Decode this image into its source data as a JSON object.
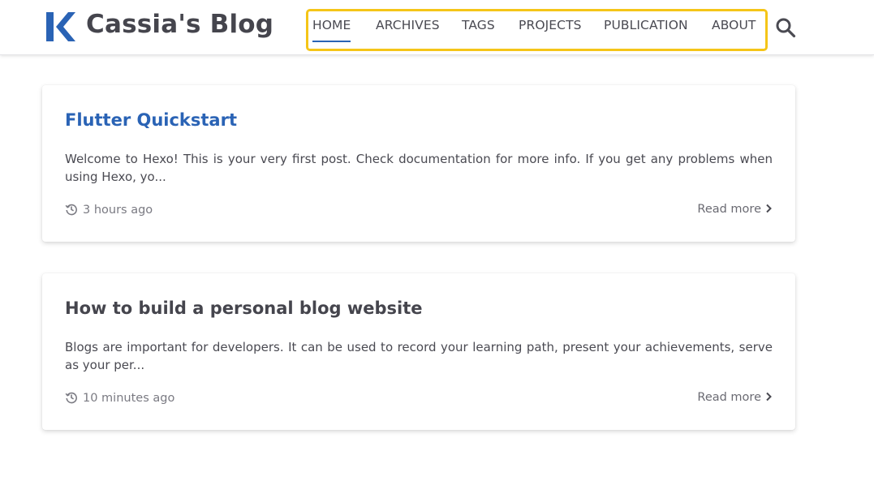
{
  "site": {
    "title": "Cassia's Blog",
    "brand_color": "#2a63b5"
  },
  "nav": {
    "items": [
      {
        "label": "HOME",
        "active": true
      },
      {
        "label": "ARCHIVES",
        "active": false
      },
      {
        "label": "TAGS",
        "active": false
      },
      {
        "label": "PROJECTS",
        "active": false
      },
      {
        "label": "PUBLICATION",
        "active": false
      },
      {
        "label": "ABOUT",
        "active": false
      }
    ],
    "highlight_color": "#f5c518",
    "search_icon": "search-icon"
  },
  "posts": [
    {
      "title": "Flutter Quickstart",
      "title_color": "#2a63b5",
      "excerpt": "Welcome to Hexo! This is your very first post. Check documentation for more info. If you get any problems when using Hexo, yo...",
      "time": "3 hours ago",
      "read_more": "Read more"
    },
    {
      "title": "How to build a personal blog website",
      "title_color": "#45454d",
      "excerpt": "Blogs are important for developers. It can be used to record your learning path, present your achievements, serve as your per...",
      "time": "10 minutes ago",
      "read_more": "Read more"
    }
  ]
}
